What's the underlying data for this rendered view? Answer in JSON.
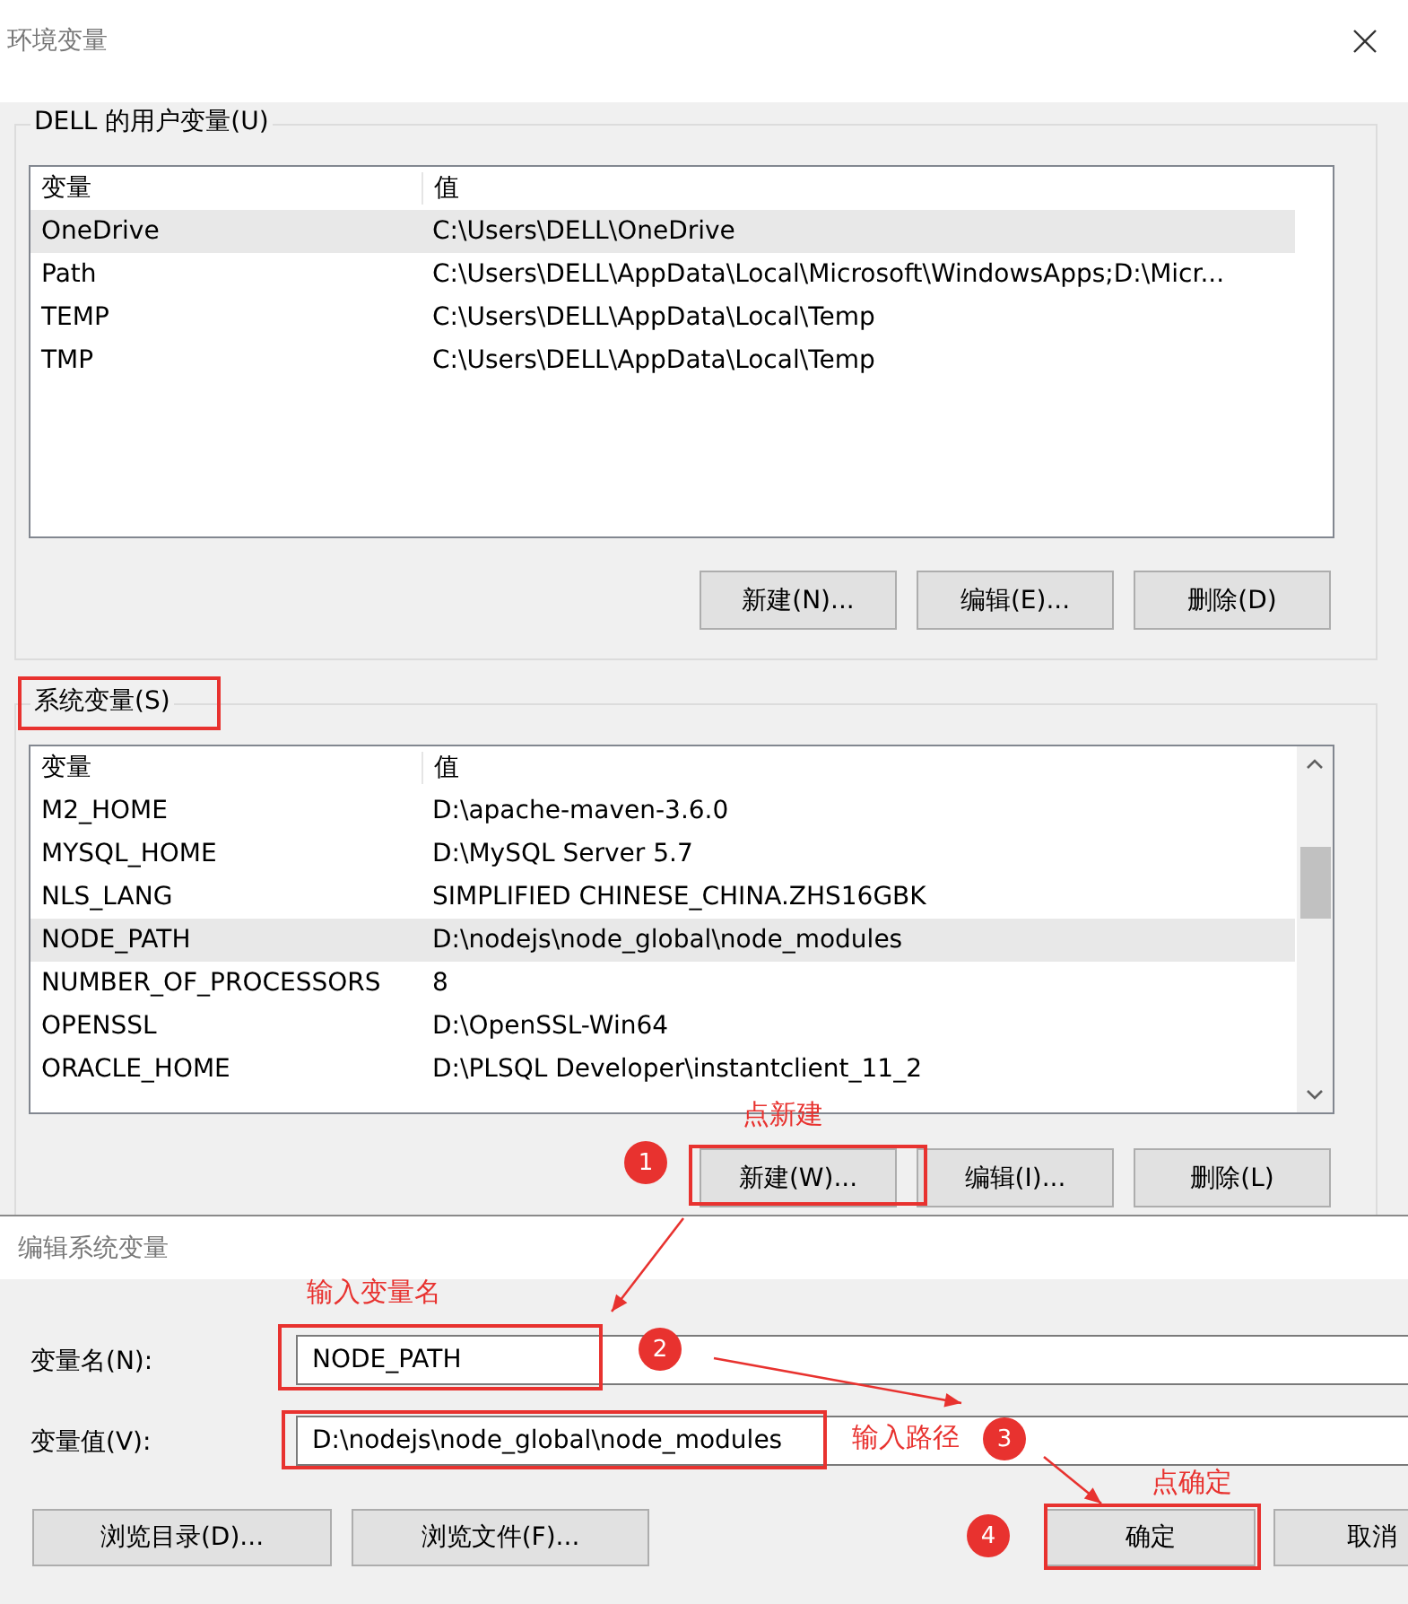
{
  "main_dialog": {
    "title": "环境变量",
    "user_group": {
      "label": "DELL 的用户变量(U)",
      "columns": [
        "变量",
        "值"
      ],
      "rows": [
        {
          "name": "OneDrive",
          "value": "C:\\Users\\DELL\\OneDrive",
          "selected": true
        },
        {
          "name": "Path",
          "value": "C:\\Users\\DELL\\AppData\\Local\\Microsoft\\WindowsApps;D:\\Micr...",
          "selected": false
        },
        {
          "name": "TEMP",
          "value": "C:\\Users\\DELL\\AppData\\Local\\Temp",
          "selected": false
        },
        {
          "name": "TMP",
          "value": "C:\\Users\\DELL\\AppData\\Local\\Temp",
          "selected": false
        }
      ],
      "buttons": [
        "新建(N)...",
        "编辑(E)...",
        "删除(D)"
      ]
    },
    "system_group": {
      "label": "系统变量(S)",
      "columns": [
        "变量",
        "值"
      ],
      "rows": [
        {
          "name": "M2_HOME",
          "value": "D:\\apache-maven-3.6.0",
          "selected": false
        },
        {
          "name": "MYSQL_HOME",
          "value": "D:\\MySQL Server 5.7",
          "selected": false
        },
        {
          "name": "NLS_LANG",
          "value": "SIMPLIFIED CHINESE_CHINA.ZHS16GBK",
          "selected": false
        },
        {
          "name": "NODE_PATH",
          "value": "D:\\nodejs\\node_global\\node_modules",
          "selected": true
        },
        {
          "name": "NUMBER_OF_PROCESSORS",
          "value": "8",
          "selected": false
        },
        {
          "name": "OPENSSL",
          "value": "D:\\OpenSSL-Win64",
          "selected": false
        },
        {
          "name": "ORACLE_HOME",
          "value": "D:\\PLSQL Developer\\instantclient_11_2",
          "selected": false
        }
      ],
      "buttons": [
        "新建(W)...",
        "编辑(I)...",
        "删除(L)"
      ]
    }
  },
  "edit_dialog": {
    "title": "编辑系统变量",
    "fields": [
      {
        "label": "变量名(N):",
        "value": "NODE_PATH"
      },
      {
        "label": "变量值(V):",
        "value": "D:\\nodejs\\node_global\\node_modules"
      }
    ],
    "buttons": [
      "浏览目录(D)...",
      "浏览文件(F)...",
      "确定",
      "取消"
    ]
  },
  "annotations": [
    {
      "number": "1",
      "note": "点新建"
    },
    {
      "number": "2",
      "note": "输入变量名"
    },
    {
      "number": "3",
      "note": "输入路径"
    },
    {
      "number": "4",
      "note": "点确定"
    }
  ]
}
